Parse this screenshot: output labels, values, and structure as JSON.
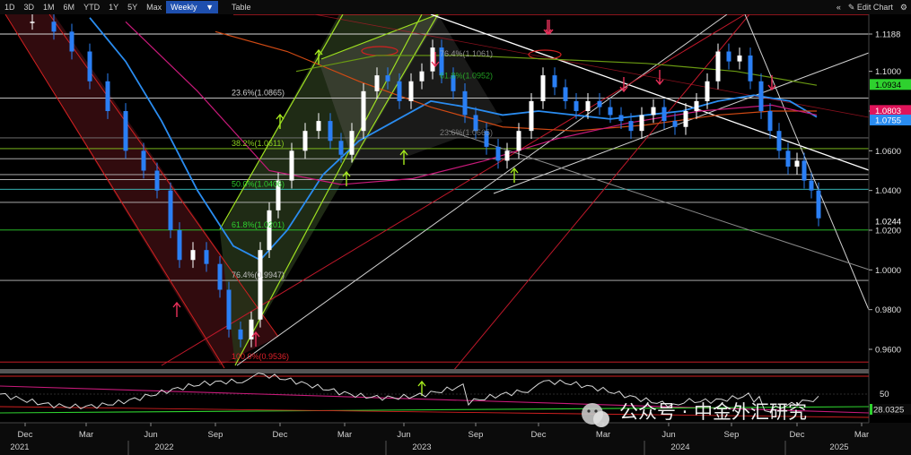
{
  "toolbar": {
    "ranges": [
      "1D",
      "3D",
      "1M",
      "6M",
      "YTD",
      "1Y",
      "5Y",
      "Max"
    ],
    "interval": "Weekly",
    "interval_arrow": "▼",
    "table": "Table",
    "edit_label": "Edit Chart",
    "collapse_icon": "«",
    "edit_icon": "✎",
    "settings_icon": "⚙"
  },
  "watermark": "公众号 · 中金外汇研究",
  "chart_data": {
    "type": "candlestick",
    "frequency": "weekly",
    "x_ticks": [
      "Dec",
      "Mar",
      "Jun",
      "Sep",
      "Dec",
      "Mar",
      "Jun",
      "Sep",
      "Dec",
      "Mar",
      "Jun",
      "Sep",
      "Dec",
      "Mar"
    ],
    "x_years": [
      "2021",
      "2022",
      "2023",
      "2024",
      "2025"
    ],
    "ylim": [
      0.945,
      1.13
    ],
    "y_ticks": [
      1.1188,
      1.1,
      1.08,
      1.06,
      1.04,
      1.02,
      1.0,
      0.98,
      0.96
    ],
    "price_tags": [
      {
        "value": 1.0934,
        "color": "#2ed12e"
      },
      {
        "value": 1.0803,
        "color": "#e0145a"
      },
      {
        "value": 1.0755,
        "color": "#2a8cf0"
      },
      {
        "value": 1.0244,
        "color": "#ffffff"
      }
    ],
    "fibonacci_1": [
      {
        "label": "23.6%(1.0865)",
        "value": 1.0865
      },
      {
        "label": "38.2%(1.0611)",
        "value": 1.0611
      },
      {
        "label": "50.0%(1.0406)",
        "value": 1.0406
      },
      {
        "label": "61.8%(1.0201)",
        "value": 1.0201
      },
      {
        "label": "76.4%(0.9947)",
        "value": 0.9947
      },
      {
        "label": "100.0%(0.9536)",
        "value": 0.9536
      }
    ],
    "fibonacci_2": [
      {
        "label": "76.4%(1.1061)",
        "value": 1.1061
      },
      {
        "label": "61.8%(1.0952)",
        "value": 1.0952
      },
      {
        "label": "23.6%(1.0665)",
        "value": 1.0665
      }
    ],
    "indicator": {
      "ticks": [
        50
      ],
      "value": 28.0325,
      "value_color": "#2ed12e"
    }
  }
}
